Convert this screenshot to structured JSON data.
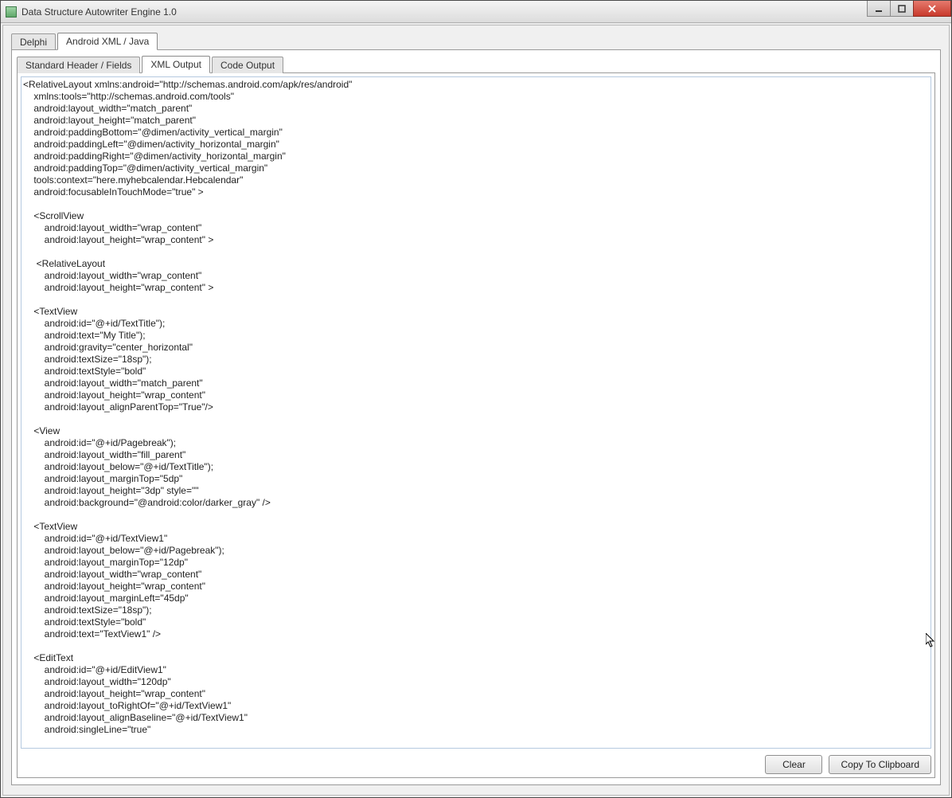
{
  "window": {
    "title": "Data Structure Autowriter Engine 1.0"
  },
  "tabs_primary": {
    "items": [
      {
        "label": "Delphi",
        "active": false
      },
      {
        "label": "Android XML / Java",
        "active": true
      }
    ]
  },
  "tabs_secondary": {
    "items": [
      {
        "label": "Standard Header / Fields",
        "active": false
      },
      {
        "label": "XML Output",
        "active": true
      },
      {
        "label": "Code Output",
        "active": false
      }
    ]
  },
  "xml_output": "<RelativeLayout xmlns:android=\"http://schemas.android.com/apk/res/android\"\n    xmlns:tools=\"http://schemas.android.com/tools\"\n    android:layout_width=\"match_parent\"\n    android:layout_height=\"match_parent\"\n    android:paddingBottom=\"@dimen/activity_vertical_margin\"\n    android:paddingLeft=\"@dimen/activity_horizontal_margin\"\n    android:paddingRight=\"@dimen/activity_horizontal_margin\"\n    android:paddingTop=\"@dimen/activity_vertical_margin\"\n    tools:context=\"here.myhebcalendar.Hebcalendar\"\n    android:focusableInTouchMode=\"true\" >\n\n    <ScrollView\n        android:layout_width=\"wrap_content\"\n        android:layout_height=\"wrap_content\" >\n\n     <RelativeLayout\n        android:layout_width=\"wrap_content\"\n        android:layout_height=\"wrap_content\" >\n\n    <TextView\n        android:id=\"@+id/TextTitle\");\n        android:text=\"My Title\");\n        android:gravity=\"center_horizontal\"\n        android:textSize=\"18sp\");\n        android:textStyle=\"bold\"\n        android:layout_width=\"match_parent\"\n        android:layout_height=\"wrap_content\"\n        android:layout_alignParentTop=\"True\"/>\n\n    <View\n        android:id=\"@+id/Pagebreak\");\n        android:layout_width=\"fill_parent\"\n        android:layout_below=\"@+id/TextTitle\");\n        android:layout_marginTop=\"5dp\"\n        android:layout_height=\"3dp\" style=\"\"\n        android:background=\"@android:color/darker_gray\" />\n\n    <TextView\n        android:id=\"@+id/TextView1\"\n        android:layout_below=\"@+id/Pagebreak\");\n        android:layout_marginTop=\"12dp\"\n        android:layout_width=\"wrap_content\"\n        android:layout_height=\"wrap_content\"\n        android:layout_marginLeft=\"45dp\"\n        android:textSize=\"18sp\");\n        android:textStyle=\"bold\"\n        android:text=\"TextView1\" />\n\n    <EditText\n        android:id=\"@+id/EditView1\"\n        android:layout_width=\"120dp\"\n        android:layout_height=\"wrap_content\"\n        android:layout_toRightOf=\"@+id/TextView1\"\n        android:layout_alignBaseline=\"@+id/TextView1\"\n        android:singleLine=\"true\"",
  "buttons": {
    "clear": "Clear",
    "copy": "Copy To Clipboard"
  }
}
